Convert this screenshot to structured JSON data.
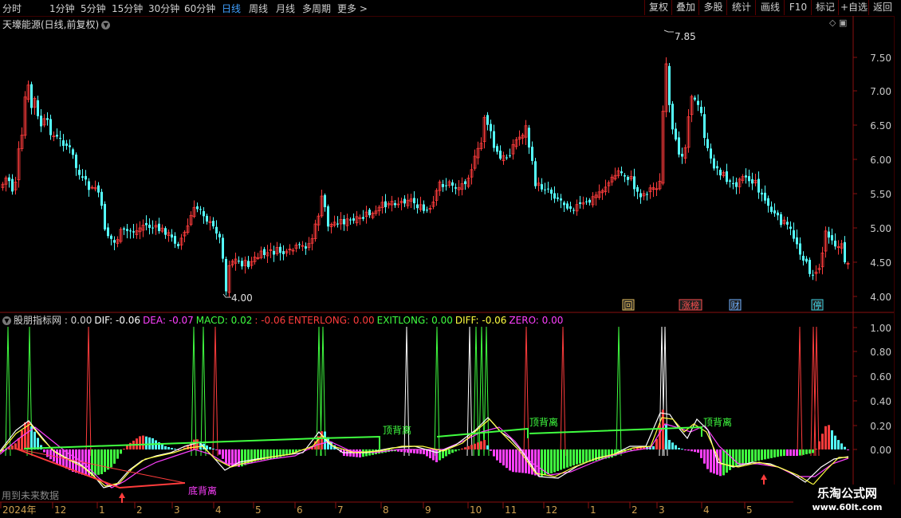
{
  "toolbar": {
    "periods": [
      "分时",
      "1分钟",
      "5分钟",
      "15分钟",
      "30分钟",
      "60分钟",
      "日线",
      "周线",
      "月线",
      "多周期",
      "更多"
    ],
    "active_period": "日线",
    "more_arrow": ">",
    "buttons": [
      "复权",
      "叠加",
      "多股",
      "统计",
      "画线",
      "F10",
      "标记",
      "+自选",
      "返回"
    ]
  },
  "main_chart": {
    "title": "天壕能源(日线,前复权)",
    "y_ticks": [
      "7.50",
      "7.00",
      "6.50",
      "6.00",
      "5.50",
      "5.00",
      "4.50",
      "4.00"
    ],
    "high_label": "7.85",
    "low_label": "4.00",
    "event_badges": [
      {
        "text": "回",
        "color": "#e8c060"
      },
      {
        "text": "涨榜",
        "color": "#ff5050"
      },
      {
        "text": "财",
        "color": "#70b0ff"
      },
      {
        "text": "停",
        "color": "#40d0e0"
      }
    ],
    "candles_up_color": "#ff3c3c",
    "candles_down_color": "#54ffff"
  },
  "indicator": {
    "legend": [
      {
        "text": "股朋指标网 : 0.00",
        "color": "#d8d8d8"
      },
      {
        "text": "DIF: -0.06",
        "color": "#ffffff"
      },
      {
        "text": "DEA: -0.07",
        "color": "#ff40ff"
      },
      {
        "text": "MACD: 0.02",
        "color": "#40ff40"
      },
      {
        "text": ": -0.06",
        "color": "#ff3c3c"
      },
      {
        "text": "ENTERLONG: 0.00",
        "color": "#ff3c3c"
      },
      {
        "text": "EXITLONG: 0.00",
        "color": "#40ff40"
      },
      {
        "text": "DIFF: -0.06",
        "color": "#ffff40"
      },
      {
        "text": "ZERO: 0.00",
        "color": "#ff40ff"
      }
    ],
    "y_ticks": [
      "1.00",
      "0.80",
      "0.60",
      "0.40",
      "0.20",
      "0.00"
    ],
    "labels": [
      {
        "text": "顶背离",
        "color": "#40ff40"
      },
      {
        "text": "顶背离",
        "color": "#40ff40"
      },
      {
        "text": "顶背离",
        "color": "#40ff40"
      },
      {
        "text": "底背离",
        "color": "#ff40ff"
      }
    ],
    "future_note": "用到未来数据"
  },
  "time_axis": [
    "2024年",
    "12",
    "1",
    "2",
    "3",
    "4",
    "5",
    "6",
    "7",
    "8",
    "9",
    "10",
    "11",
    "12",
    "1",
    "2",
    "3",
    "4",
    "5"
  ],
  "watermark": {
    "name": "乐淘公式网",
    "url": "www.60lt.com"
  }
}
